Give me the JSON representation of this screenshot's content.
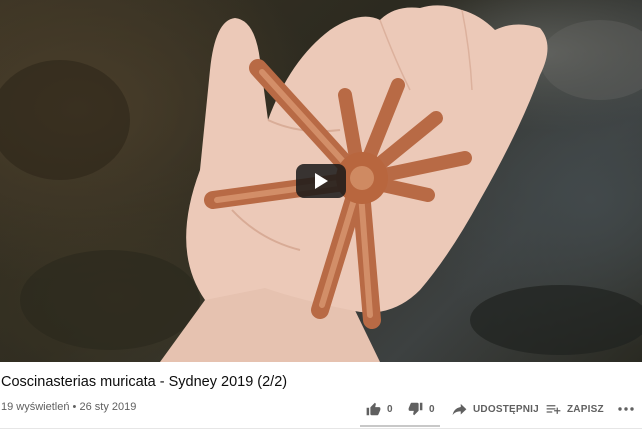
{
  "video": {
    "title": "Coscinasterias muricata - Sydney 2019 (2/2)",
    "views": "19 wyświetleń",
    "separator": "•",
    "date": "26 sty 2019"
  },
  "actions": {
    "like_count": "0",
    "dislike_count": "0",
    "share_label": "UDOSTĘPNIJ",
    "save_label": "ZAPISZ"
  },
  "icons": {
    "play": "play-icon",
    "like": "thumb-up-icon",
    "dislike": "thumb-down-icon",
    "share": "share-arrow-icon",
    "save": "playlist-add-icon",
    "more": "more-horizontal-icon"
  },
  "colors": {
    "title": "#0d0d0d",
    "meta": "#606060",
    "play_button": "#1a1a1a"
  }
}
